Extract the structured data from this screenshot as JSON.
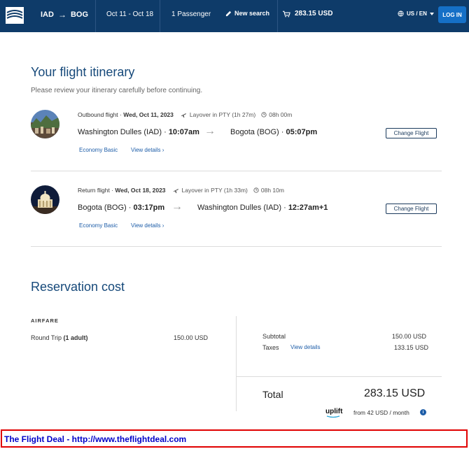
{
  "header": {
    "origin": "IAD",
    "destination": "BOG",
    "route_arrow": "→",
    "dates": "Oct 11 - Oct 18",
    "passengers": "1 Passenger",
    "new_search": "New search",
    "cart_total": "283.15 USD",
    "locale": "US / EN",
    "login": "LOG IN",
    "colors": {
      "bar": "#0e3b69",
      "login": "#1570c7"
    }
  },
  "itinerary": {
    "title": "Your flight itinerary",
    "subtitle": "Please review your itinerary carefully before continuing."
  },
  "flights": [
    {
      "type_label": "Outbound flight",
      "date": "Wed, Oct 11, 2023",
      "layover": "Layover in PTY (1h 27m)",
      "duration": "08h 00m",
      "from_city": "Washington Dulles (IAD)",
      "from_time": "10:07am",
      "to_city": "Bogota (BOG)",
      "to_time": "05:07pm",
      "fare": "Economy Basic",
      "details": "View details",
      "change": "Change Flight"
    },
    {
      "type_label": "Return flight",
      "date": "Wed, Oct 18, 2023",
      "layover": "Layover in PTY (1h 33m)",
      "duration": "08h 10m",
      "from_city": "Bogota (BOG)",
      "from_time": "03:17pm",
      "to_city": "Washington Dulles (IAD)",
      "to_time": "12:27am+1",
      "fare": "Economy Basic",
      "details": "View details",
      "change": "Change Flight"
    }
  ],
  "cost": {
    "title": "Reservation cost",
    "airfare_label": "AIRFARE",
    "trip_label": "Round Trip",
    "trip_adults": "(1 adult)",
    "trip_value": "150.00 USD",
    "subtotal_label": "Subtotal",
    "subtotal_value": "150.00 USD",
    "taxes_label": "Taxes",
    "taxes_link": "View details",
    "taxes_value": "133.15 USD",
    "total_label": "Total",
    "total_value": "283.15 USD",
    "uplift_brand": "uplift",
    "uplift_text": "from 42 USD  / month",
    "info": "i"
  },
  "banner": {
    "text": "The Flight Deal - http://www.theflightdeal.com",
    "colors": {
      "border": "#e00000",
      "text": "#0000c8"
    }
  }
}
